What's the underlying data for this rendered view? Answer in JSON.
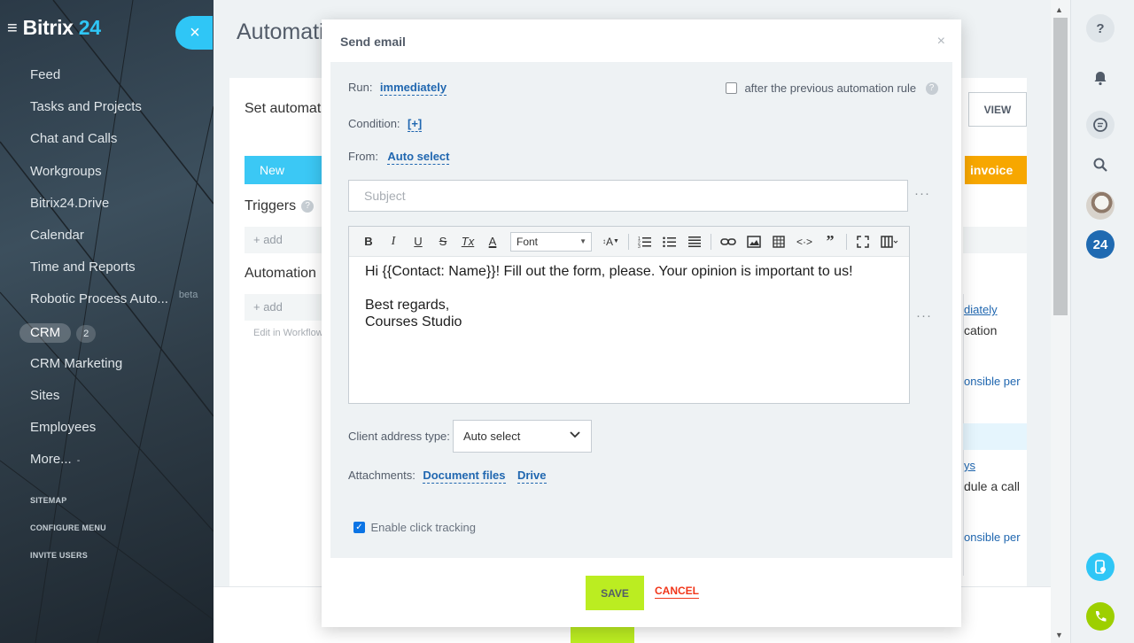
{
  "sidebar": {
    "logo_word": "Bitrix",
    "logo_num": "24",
    "close_symbol": "×",
    "items": [
      {
        "label": "Feed"
      },
      {
        "label": "Tasks and Projects"
      },
      {
        "label": "Chat and Calls"
      },
      {
        "label": "Workgroups"
      },
      {
        "label": "Bitrix24.Drive"
      },
      {
        "label": "Calendar"
      },
      {
        "label": "Time and Reports"
      },
      {
        "label": "Robotic Process Auto...",
        "badge": "beta"
      },
      {
        "label": "CRM",
        "count": "2"
      },
      {
        "label": "CRM Marketing"
      },
      {
        "label": "Sites"
      },
      {
        "label": "Employees"
      },
      {
        "label": "More...",
        "suffix": "-"
      }
    ],
    "small_links": [
      "SITEMAP",
      "CONFIGURE MENU",
      "INVITE USERS"
    ]
  },
  "background": {
    "title": "Automati",
    "subtitle": "Set automat",
    "view_label": "VIEW",
    "new_label": "New",
    "invoice_label": "invoice",
    "triggers_label": "Triggers",
    "triggers_help": "?",
    "add_label": "+ add",
    "automation_label": "Automation",
    "edit_label": "Edit in Workflow",
    "right_text_1": "diately",
    "right_text_2": "cation",
    "right_text_3": "onsible per",
    "right_text_4": "ys",
    "right_text_5": "dule a call",
    "right_text_6": "onsible per"
  },
  "modal": {
    "title": "Send email",
    "close_symbol": "×",
    "run_label": "Run:",
    "run_value": "immediately",
    "after_previous_label": "after the previous automation rule",
    "help_symbol": "?",
    "condition_label": "Condition:",
    "condition_value": "[+]",
    "from_label": "From:",
    "from_value": "Auto select",
    "subject_placeholder": "Subject",
    "more_dots": "···",
    "toolbar": {
      "bold": "B",
      "italic": "I",
      "underline": "U",
      "strike": "S",
      "clear": "Tx",
      "color": "A",
      "font": "Font",
      "size": "A"
    },
    "body_line_1": "Hi {{Contact: Name}}! Fill out the form, please. Your opinion is important to us!",
    "body_line_2": "Best regards,",
    "body_line_3": "Courses Studio",
    "client_address_label": "Client address type:",
    "client_address_value": "Auto select",
    "attachments_label": "Attachments:",
    "attachment_document": "Document files",
    "attachment_drive": "Drive",
    "click_tracking_label": "Enable click tracking",
    "click_tracking_checked": true,
    "save_label": "SAVE",
    "cancel_label": "CANCEL"
  },
  "right_panel": {
    "help_symbol": "?",
    "badge_24": "24"
  },
  "colors": {
    "accent": "#2fc6f6",
    "link": "#2067b0",
    "save": "#bbed21",
    "cancel": "#f1361a"
  }
}
